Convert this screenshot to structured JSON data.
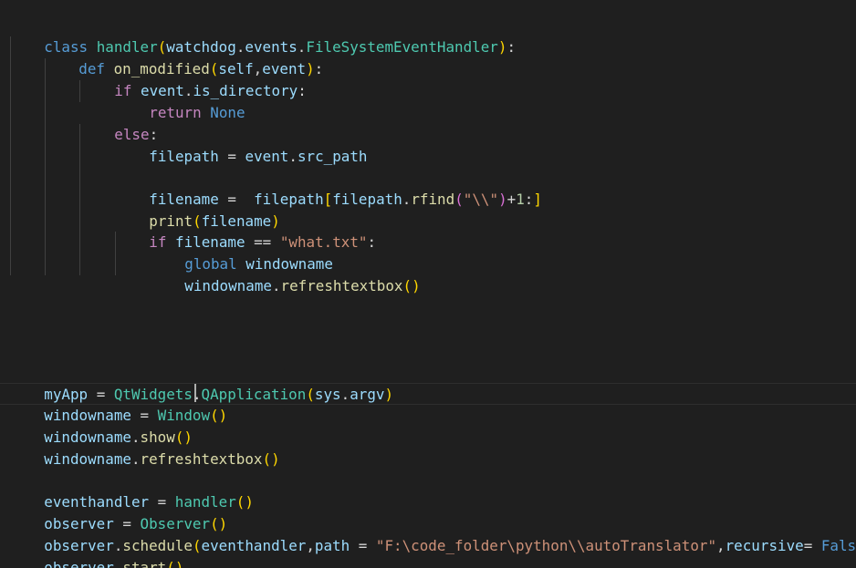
{
  "editor": {
    "colors": {
      "background": "#1f1f1f",
      "keyword": "#569cd6",
      "control": "#c586c0",
      "class": "#4ec9b0",
      "function": "#dcdcaa",
      "variable": "#9cdcfe",
      "string": "#ce9178",
      "number": "#b5cea8",
      "bracket1": "#ffd700",
      "bracket2": "#da70d6",
      "bracket3": "#179fff"
    },
    "code": {
      "l1": [
        "class",
        " ",
        "handler",
        "(",
        "watchdog",
        ".",
        "events",
        ".",
        "FileSystemEventHandler",
        ")",
        ":"
      ],
      "l2": [
        "def",
        " ",
        "on_modified",
        "(",
        "self",
        ",",
        "event",
        ")",
        ":"
      ],
      "l3": [
        "if",
        " ",
        "event",
        ".",
        "is_directory",
        ":"
      ],
      "l4": [
        "return",
        " ",
        "None"
      ],
      "l5": [
        "else",
        ":"
      ],
      "l6": [
        "filepath",
        " = ",
        "event",
        ".",
        "src_path"
      ],
      "l8": [
        "filename",
        " =  ",
        "filepath",
        "[",
        "filepath",
        ".",
        "rfind",
        "(",
        "\"\\\\\"",
        ")",
        "+",
        "1",
        ":",
        "]"
      ],
      "l9": [
        "print",
        "(",
        "filename",
        ")"
      ],
      "l10": [
        "if",
        " ",
        "filename",
        " == ",
        "\"what.txt\"",
        ":"
      ],
      "l11": [
        "global",
        " ",
        "windowname"
      ],
      "l12": [
        "windowname",
        ".",
        "refreshtextbox",
        "(",
        ")"
      ],
      "l17": [
        "myApp",
        " = ",
        "QtWidgets",
        ".",
        "QApplication",
        "(",
        "sys",
        ".",
        "argv",
        ")"
      ],
      "l18": [
        "windowname",
        " = ",
        "Window",
        "(",
        ")"
      ],
      "l19": [
        "windowname",
        ".",
        "show",
        "(",
        ")"
      ],
      "l20": [
        "windowname",
        ".",
        "refreshtextbox",
        "(",
        ")"
      ],
      "l22": [
        "eventhandler",
        " = ",
        "handler",
        "(",
        ")"
      ],
      "l23": [
        "observer",
        " = ",
        "Observer",
        "(",
        ")"
      ],
      "l24": [
        "observer",
        ".",
        "schedule",
        "(",
        "eventhandler",
        ",",
        "path",
        " = ",
        "\"F:\\code_folder\\python\\\\autoTranslator\"",
        ",",
        "recursive",
        "= ",
        "False",
        ")"
      ],
      "l25": [
        "observer",
        ".",
        "start",
        "(",
        ")"
      ]
    }
  }
}
